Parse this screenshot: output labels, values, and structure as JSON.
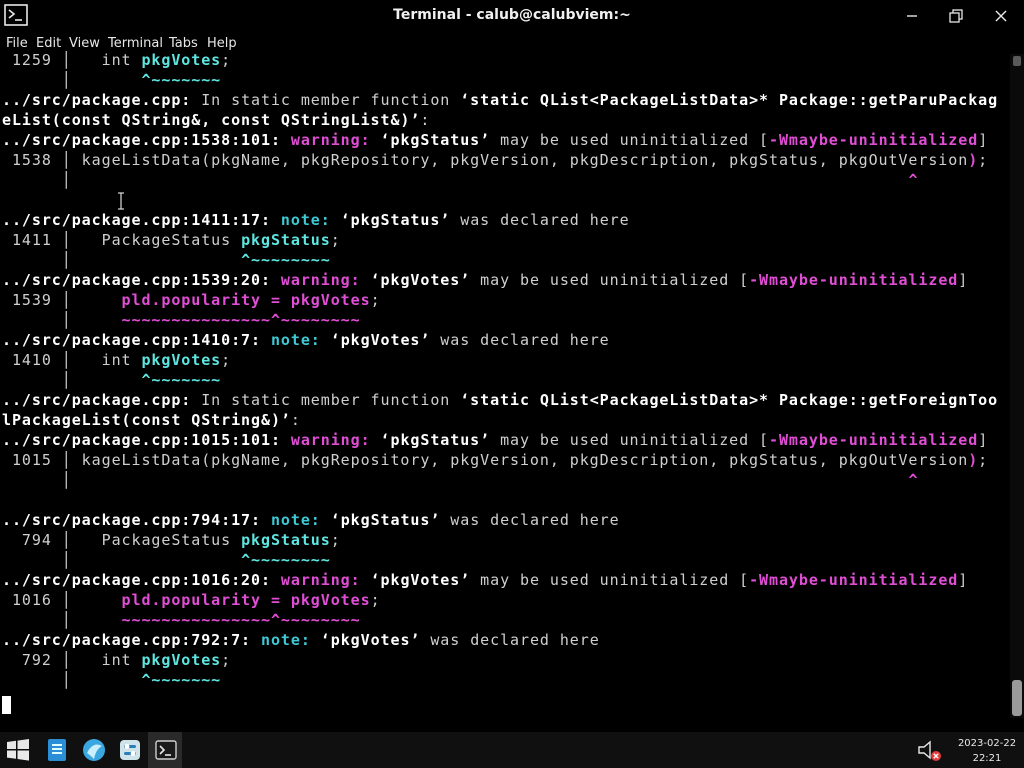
{
  "window": {
    "title": "Terminal - calub@calubviem:~"
  },
  "icons": {
    "app": "terminal-icon",
    "minimize": "minimize-icon",
    "maximize": "maximize-icon",
    "close": "close-icon",
    "start": "windows-start-icon",
    "files": "file-manager-icon",
    "browser": "browser-icon",
    "settings": "settings-icon",
    "terminal_task": "terminal-icon",
    "volume": "volume-muted-icon"
  },
  "menu": [
    "File",
    "Edit",
    "View",
    "Terminal",
    "Tabs",
    "Help"
  ],
  "colors": {
    "warning": "#e14ed6",
    "note": "#3fc9d4",
    "highlight": "#5ee6e0",
    "text": "#cfcfcf",
    "bold": "#ffffff",
    "background": "#000000"
  },
  "terminal": {
    "lines": [
      [
        {
          "t": " 1259 │   int ",
          "c": "lnum"
        },
        {
          "t": "pkgVotes",
          "c": "hl"
        },
        {
          "t": ";",
          "c": ""
        }
      ],
      [
        {
          "t": "      │       ",
          "c": "lnum"
        },
        {
          "t": "^~~~~~~~",
          "c": "hl"
        }
      ],
      [
        {
          "t": "../src/package.cpp:",
          "c": "b"
        },
        {
          "t": " In static member function ",
          "c": ""
        },
        {
          "t": "‘static QList<PackageListData>* Package::getParuPackag",
          "c": "b"
        }
      ],
      [
        {
          "t": "eList(const QString&, const QStringList&)’",
          "c": "b"
        },
        {
          "t": ":",
          "c": ""
        }
      ],
      [
        {
          "t": "../src/package.cpp:1538:101:",
          "c": "b"
        },
        {
          "t": " ",
          "c": ""
        },
        {
          "t": "warning:",
          "c": "warn"
        },
        {
          "t": " ",
          "c": ""
        },
        {
          "t": "‘pkgStatus’",
          "c": "b"
        },
        {
          "t": " may be used uninitialized [",
          "c": ""
        },
        {
          "t": "-Wmaybe-uninitialized",
          "c": "mag"
        },
        {
          "t": "]",
          "c": ""
        }
      ],
      [
        {
          "t": " 1538 │ kageListData(pkgName, pkgRepository, pkgVersion, pkgDescription, pkgStatus, pkgOutVersion",
          "c": ""
        },
        {
          "t": ")",
          "c": "mag"
        },
        {
          "t": ";",
          "c": ""
        }
      ],
      [
        {
          "t": "      │                                                                                    ",
          "c": "lnum"
        },
        {
          "t": "^",
          "c": "mag"
        }
      ],
      [],
      [
        {
          "t": "../src/package.cpp:1411:17:",
          "c": "b"
        },
        {
          "t": " ",
          "c": ""
        },
        {
          "t": "note:",
          "c": "note"
        },
        {
          "t": " ",
          "c": ""
        },
        {
          "t": "‘pkgStatus’",
          "c": "b"
        },
        {
          "t": " was declared here",
          "c": ""
        }
      ],
      [
        {
          "t": " 1411 │   PackageStatus ",
          "c": ""
        },
        {
          "t": "pkgStatus",
          "c": "hl"
        },
        {
          "t": ";",
          "c": ""
        }
      ],
      [
        {
          "t": "      │                 ",
          "c": "lnum"
        },
        {
          "t": "^~~~~~~~~",
          "c": "hl"
        }
      ],
      [
        {
          "t": "../src/package.cpp:1539:20:",
          "c": "b"
        },
        {
          "t": " ",
          "c": ""
        },
        {
          "t": "warning:",
          "c": "warn"
        },
        {
          "t": " ",
          "c": ""
        },
        {
          "t": "‘pkgVotes’",
          "c": "b"
        },
        {
          "t": " may be used uninitialized [",
          "c": ""
        },
        {
          "t": "-Wmaybe-uninitialized",
          "c": "mag"
        },
        {
          "t": "]",
          "c": ""
        }
      ],
      [
        {
          "t": " 1539 │     ",
          "c": ""
        },
        {
          "t": "pld.popularity = pkgVotes",
          "c": "mag"
        },
        {
          "t": ";",
          "c": ""
        }
      ],
      [
        {
          "t": "      │     ",
          "c": "lnum"
        },
        {
          "t": "~~~~~~~~~~~~~~~^~~~~~~~~",
          "c": "mag"
        }
      ],
      [
        {
          "t": "../src/package.cpp:1410:7:",
          "c": "b"
        },
        {
          "t": " ",
          "c": ""
        },
        {
          "t": "note:",
          "c": "note"
        },
        {
          "t": " ",
          "c": ""
        },
        {
          "t": "‘pkgVotes’",
          "c": "b"
        },
        {
          "t": " was declared here",
          "c": ""
        }
      ],
      [
        {
          "t": " 1410 │   int ",
          "c": ""
        },
        {
          "t": "pkgVotes",
          "c": "hl"
        },
        {
          "t": ";",
          "c": ""
        }
      ],
      [
        {
          "t": "      │       ",
          "c": "lnum"
        },
        {
          "t": "^~~~~~~~",
          "c": "hl"
        }
      ],
      [
        {
          "t": "../src/package.cpp:",
          "c": "b"
        },
        {
          "t": " In static member function ",
          "c": ""
        },
        {
          "t": "‘static QList<PackageListData>* Package::getForeignToo",
          "c": "b"
        }
      ],
      [
        {
          "t": "lPackageList(const QString&)’",
          "c": "b"
        },
        {
          "t": ":",
          "c": ""
        }
      ],
      [
        {
          "t": "../src/package.cpp:1015:101:",
          "c": "b"
        },
        {
          "t": " ",
          "c": ""
        },
        {
          "t": "warning:",
          "c": "warn"
        },
        {
          "t": " ",
          "c": ""
        },
        {
          "t": "‘pkgStatus’",
          "c": "b"
        },
        {
          "t": " may be used uninitialized [",
          "c": ""
        },
        {
          "t": "-Wmaybe-uninitialized",
          "c": "mag"
        },
        {
          "t": "]",
          "c": ""
        }
      ],
      [
        {
          "t": " 1015 │ kageListData(pkgName, pkgRepository, pkgVersion, pkgDescription, pkgStatus, pkgOutVersion",
          "c": ""
        },
        {
          "t": ")",
          "c": "mag"
        },
        {
          "t": ";",
          "c": ""
        }
      ],
      [
        {
          "t": "      │                                                                                    ",
          "c": "lnum"
        },
        {
          "t": "^",
          "c": "mag"
        }
      ],
      [],
      [
        {
          "t": "../src/package.cpp:794:17:",
          "c": "b"
        },
        {
          "t": " ",
          "c": ""
        },
        {
          "t": "note:",
          "c": "note"
        },
        {
          "t": " ",
          "c": ""
        },
        {
          "t": "‘pkgStatus’",
          "c": "b"
        },
        {
          "t": " was declared here",
          "c": ""
        }
      ],
      [
        {
          "t": "  794 │   PackageStatus ",
          "c": ""
        },
        {
          "t": "pkgStatus",
          "c": "hl"
        },
        {
          "t": ";",
          "c": ""
        }
      ],
      [
        {
          "t": "      │                 ",
          "c": "lnum"
        },
        {
          "t": "^~~~~~~~~",
          "c": "hl"
        }
      ],
      [
        {
          "t": "../src/package.cpp:1016:20:",
          "c": "b"
        },
        {
          "t": " ",
          "c": ""
        },
        {
          "t": "warning:",
          "c": "warn"
        },
        {
          "t": " ",
          "c": ""
        },
        {
          "t": "‘pkgVotes’",
          "c": "b"
        },
        {
          "t": " may be used uninitialized [",
          "c": ""
        },
        {
          "t": "-Wmaybe-uninitialized",
          "c": "mag"
        },
        {
          "t": "]",
          "c": ""
        }
      ],
      [
        {
          "t": " 1016 │     ",
          "c": ""
        },
        {
          "t": "pld.popularity = pkgVotes",
          "c": "mag"
        },
        {
          "t": ";",
          "c": ""
        }
      ],
      [
        {
          "t": "      │     ",
          "c": "lnum"
        },
        {
          "t": "~~~~~~~~~~~~~~~^~~~~~~~~",
          "c": "mag"
        }
      ],
      [
        {
          "t": "../src/package.cpp:792:7:",
          "c": "b"
        },
        {
          "t": " ",
          "c": ""
        },
        {
          "t": "note:",
          "c": "note"
        },
        {
          "t": " ",
          "c": ""
        },
        {
          "t": "‘pkgVotes’",
          "c": "b"
        },
        {
          "t": " was declared here",
          "c": ""
        }
      ],
      [
        {
          "t": "  792 │   int ",
          "c": ""
        },
        {
          "t": "pkgVotes",
          "c": "hl"
        },
        {
          "t": ";",
          "c": ""
        }
      ],
      [
        {
          "t": "      │       ",
          "c": "lnum"
        },
        {
          "t": "^~~~~~~~",
          "c": "hl"
        }
      ]
    ]
  },
  "taskbar": {
    "date": "2023-02-22",
    "time": "22:21"
  }
}
